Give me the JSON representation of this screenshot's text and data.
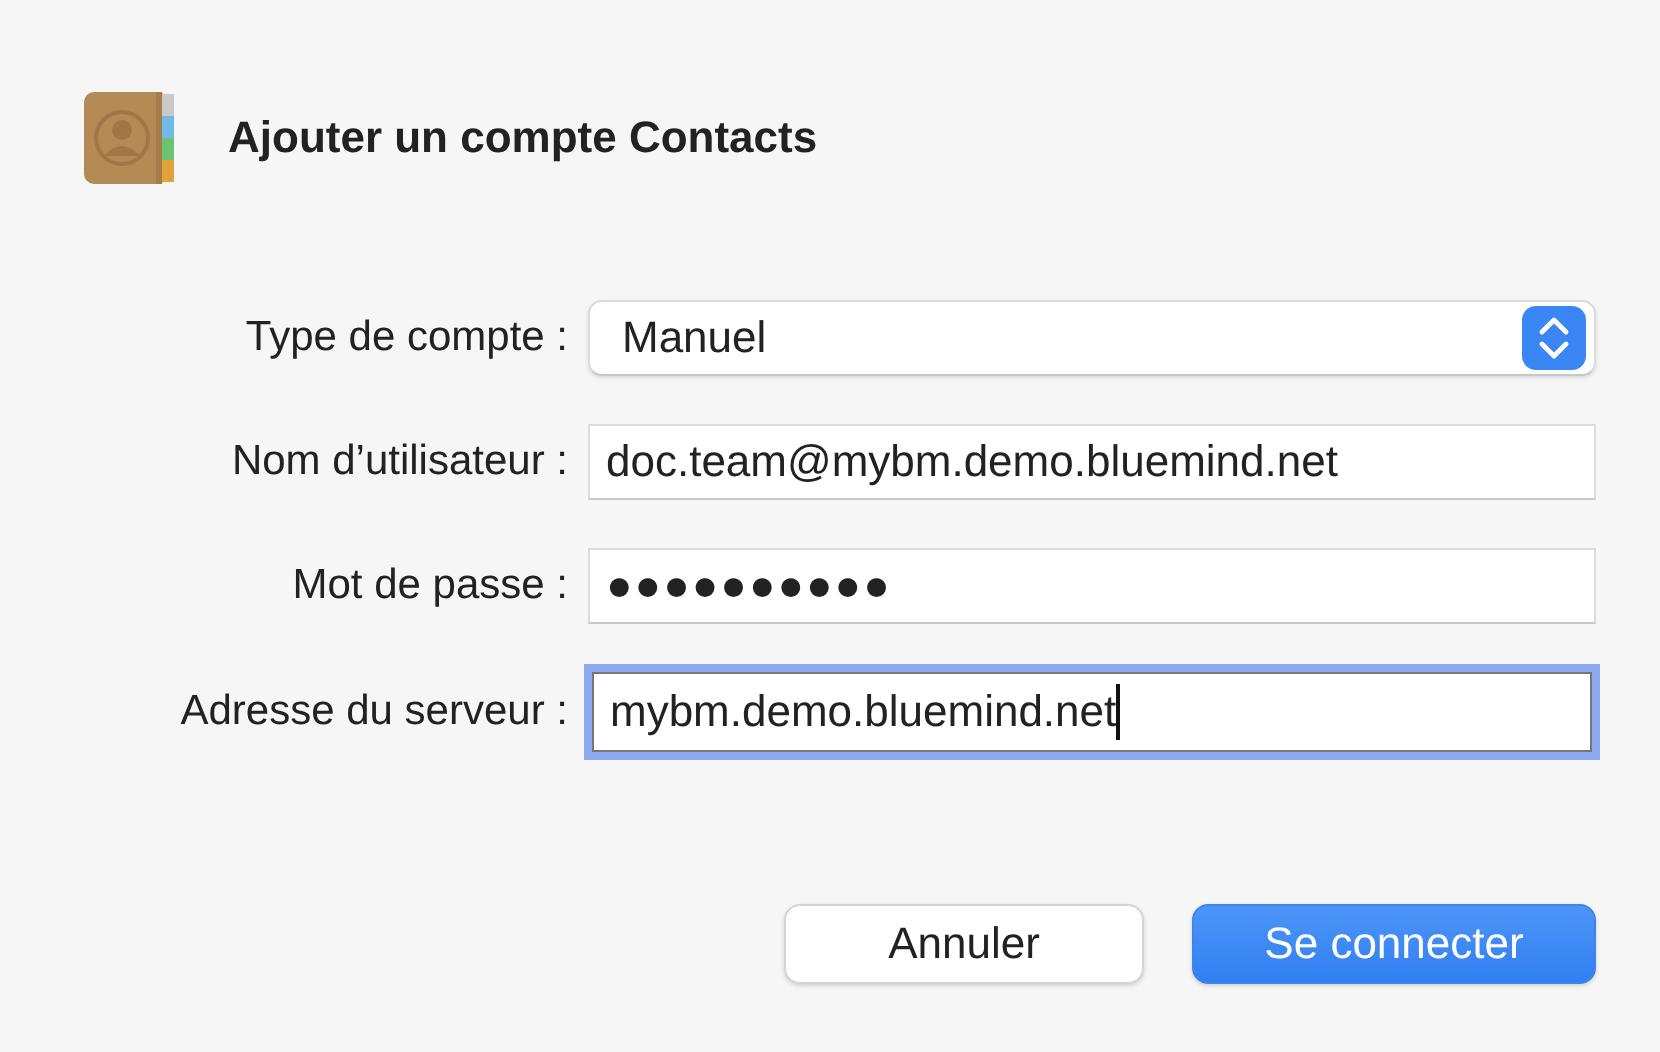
{
  "dialog": {
    "title": "Ajouter un compte Contacts"
  },
  "fields": [
    {
      "kind": "select",
      "label": "Type de compte :",
      "value": "Manuel",
      "focused": false
    },
    {
      "kind": "text",
      "label": "Nom d’utilisateur :",
      "value": "doc.team@mybm.demo.bluemind.net",
      "focused": false
    },
    {
      "kind": "password",
      "label": "Mot de passe :",
      "value": "●●●●●●●●●●",
      "focused": false
    },
    {
      "kind": "text",
      "label": "Adresse du serveur :",
      "value": "mybm.demo.bluemind.net",
      "focused": true
    }
  ],
  "buttons": [
    {
      "label": "Annuler",
      "kind": "secondary"
    },
    {
      "label": "Se connecter",
      "kind": "primary"
    }
  ]
}
